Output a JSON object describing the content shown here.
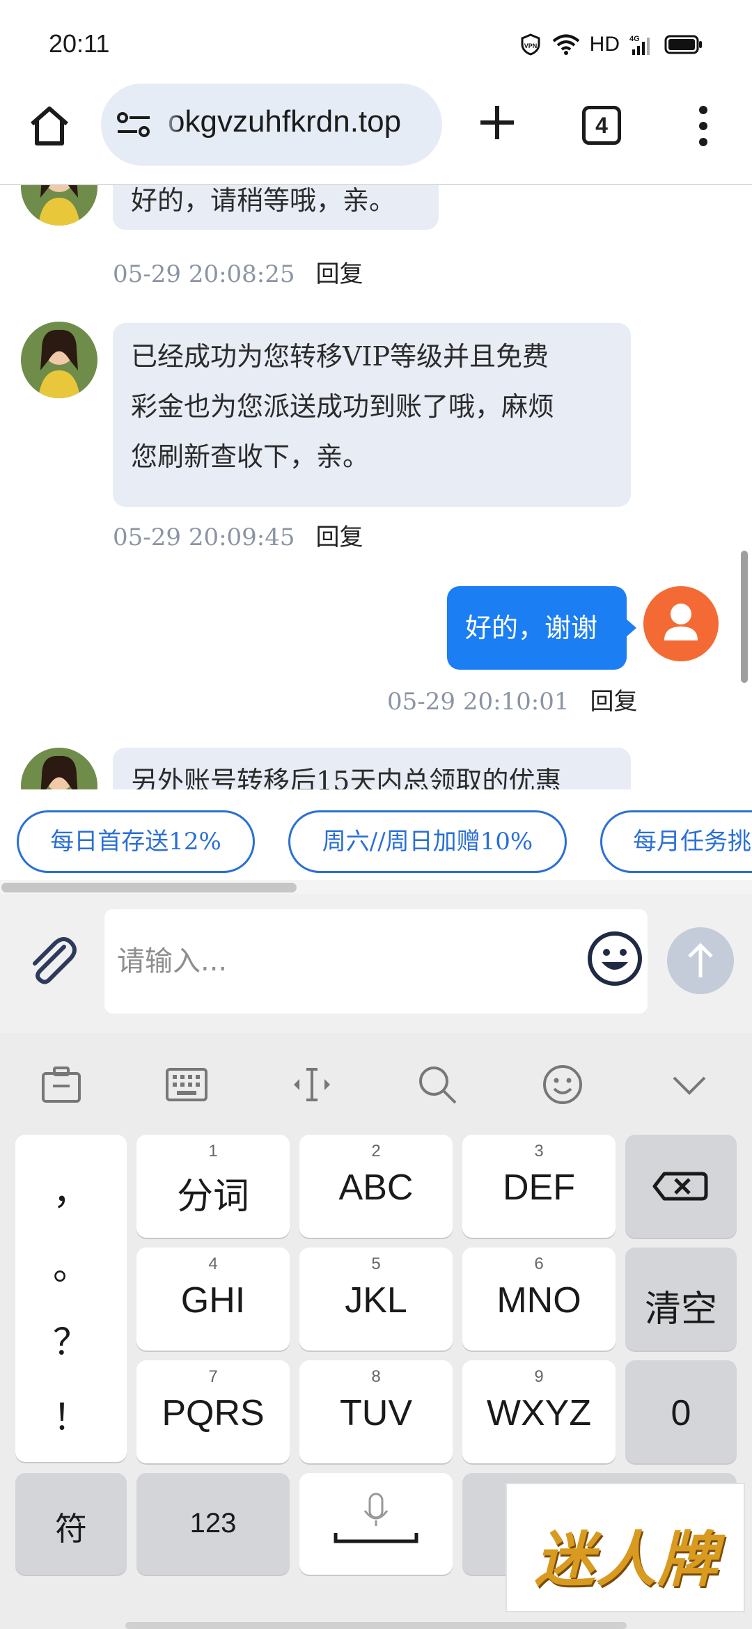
{
  "status_bar": {
    "time": "20:11",
    "hd": "HD",
    "network": "4G",
    "vpn": "VPN"
  },
  "browser": {
    "url": "okgvzuhfkrdn.top",
    "tab_count": "4"
  },
  "messages": [
    {
      "text": "好的，请稍等哦，亲。",
      "time": "05-29 20:08:25",
      "reply": "回复"
    },
    {
      "text_lines": [
        "已经成功为您转移VIP等级并且免费",
        "彩金也为您派送成功到账了哦，麻烦",
        "您刷新查收下，亲。"
      ],
      "time": "05-29 20:09:45",
      "reply": "回复"
    },
    {
      "text": "好的，谢谢",
      "time": "05-29 20:10:01",
      "reply": "回复"
    },
    {
      "text": "另外账号转移后15天内总领取的优惠"
    }
  ],
  "quick_chips": [
    "每日首存送12%",
    "周六//周日加赠10%",
    "每月任务挑"
  ],
  "input": {
    "placeholder": "请输入..."
  },
  "keyboard": {
    "punct": [
      "，",
      "。",
      "？",
      "！"
    ],
    "keys": [
      {
        "num": "1",
        "label": "分词"
      },
      {
        "num": "2",
        "label": "ABC"
      },
      {
        "num": "3",
        "label": "DEF"
      },
      {
        "num": "4",
        "label": "GHI"
      },
      {
        "num": "5",
        "label": "JKL"
      },
      {
        "num": "6",
        "label": "MNO"
      },
      {
        "num": "7",
        "label": "PQRS"
      },
      {
        "num": "8",
        "label": "TUV"
      },
      {
        "num": "9",
        "label": "WXYZ"
      }
    ],
    "clear": "清空",
    "zero": "0",
    "symbols": "符",
    "numbers": "123"
  },
  "watermark": "迷人牌",
  "colors": {
    "accent_blue": "#1c7ef3",
    "chip_blue": "#2a6fd6",
    "user_avatar": "#f46a35",
    "bubble_in": "#e7ecf5"
  }
}
